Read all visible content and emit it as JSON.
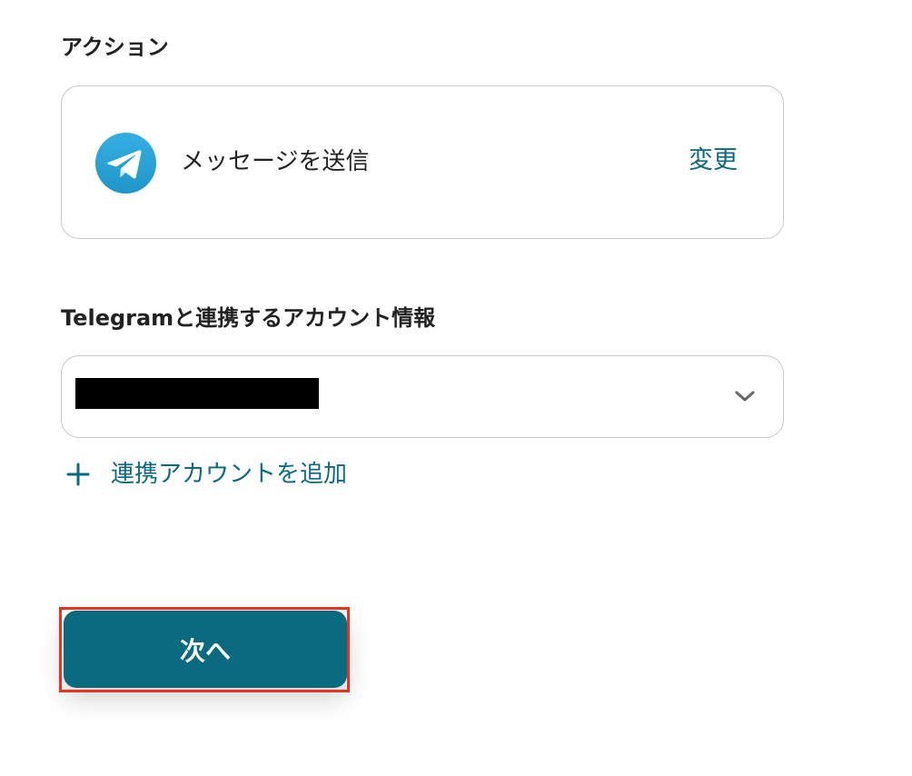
{
  "action_section": {
    "label": "アクション",
    "app_icon": "telegram-icon",
    "action_name": "メッセージを送信",
    "change_label": "変更"
  },
  "account_section": {
    "label": "Telegramと連携するアカウント情報",
    "selected_value_redacted": true,
    "dropdown_icon": "chevron-down-icon",
    "add_account_icon": "plus-icon",
    "add_account_label": "連携アカウントを追加"
  },
  "footer": {
    "next_label": "次へ"
  },
  "colors": {
    "accent": "#0c6a80",
    "button_bg": "#0a6a80",
    "border": "#c9c9c9",
    "highlight": "#e8341c",
    "telegram_blue": "#2ea6e0"
  }
}
